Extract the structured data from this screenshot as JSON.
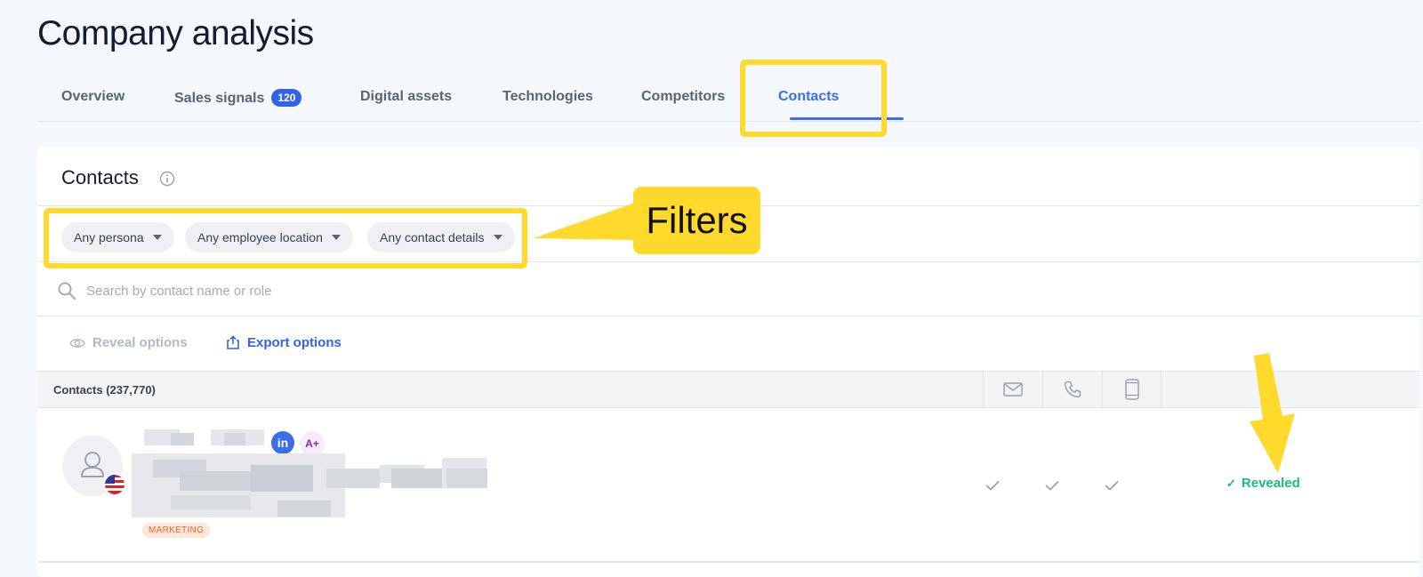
{
  "page": {
    "title": "Company analysis"
  },
  "tabs": [
    {
      "label": "Overview"
    },
    {
      "label": "Sales signals",
      "badge": "120"
    },
    {
      "label": "Digital assets"
    },
    {
      "label": "Technologies"
    },
    {
      "label": "Competitors"
    },
    {
      "label": "Contacts",
      "active": true
    }
  ],
  "contacts": {
    "title": "Contacts",
    "filters": [
      {
        "label": "Any persona"
      },
      {
        "label": "Any employee location"
      },
      {
        "label": "Any contact details"
      }
    ],
    "search": {
      "placeholder": "Search by contact name or role"
    },
    "actions": {
      "reveal": "Reveal options",
      "export": "Export options"
    },
    "table": {
      "header_label": "Contacts (237,770)",
      "columns": [
        "email-icon",
        "phone-icon",
        "mobile-icon"
      ]
    },
    "rows": [
      {
        "social": "in",
        "score": "A+",
        "department": "MARKETING",
        "flag": "us-flag-icon",
        "status": "Revealed"
      }
    ]
  },
  "annotations": {
    "callout": "Filters",
    "highlight_color": "#ffd92b"
  },
  "colors": {
    "accent": "#3b6ee8",
    "success": "#19b982",
    "badge": "#2f64ea"
  }
}
